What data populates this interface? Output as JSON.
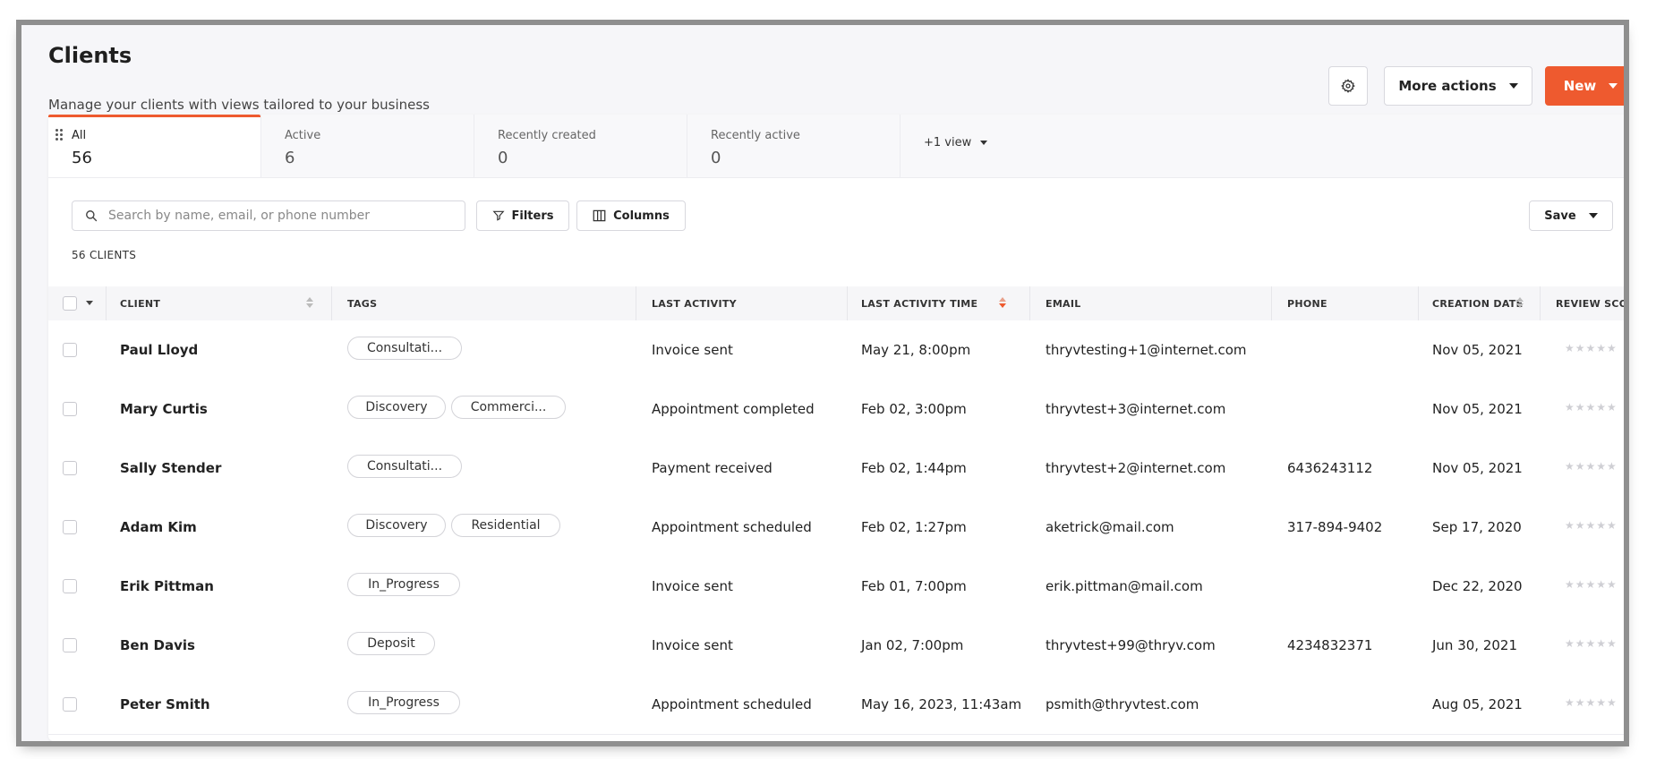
{
  "page": {
    "title": "Clients",
    "subtitle": "Manage your clients with views tailored to your business"
  },
  "actions": {
    "settings_icon": "gear-icon",
    "more_actions_label": "More actions",
    "new_label": "New"
  },
  "colors": {
    "accent": "#ee5a2f"
  },
  "tabs": [
    {
      "label": "All",
      "count": "56"
    },
    {
      "label": "Active",
      "count": "6"
    },
    {
      "label": "Recently created",
      "count": "0"
    },
    {
      "label": "Recently active",
      "count": "0"
    }
  ],
  "tabs_more_label": "+1 view",
  "toolbar": {
    "search_placeholder": "Search by name, email, or phone number",
    "filters_label": "Filters",
    "columns_label": "Columns",
    "save_label": "Save"
  },
  "clients_count_label": "56 CLIENTS",
  "columns": {
    "client": "CLIENT",
    "tags": "TAGS",
    "last_activity": "LAST ACTIVITY",
    "last_activity_time": "LAST ACTIVITY TIME",
    "email": "EMAIL",
    "phone": "PHONE",
    "creation_date": "CREATION DATE",
    "review_score": "REVIEW SCOR"
  },
  "rows": [
    {
      "client": "Paul Lloyd",
      "tags": [
        "Consultati..."
      ],
      "last_activity": "Invoice sent",
      "last_activity_time": "May 21, 8:00pm",
      "email": "thryvtesting+1@internet.com",
      "phone": "",
      "creation_date": "Nov 05, 2021",
      "stars": "★★★★★"
    },
    {
      "client": "Mary Curtis",
      "tags": [
        "Discovery",
        "Commerci..."
      ],
      "last_activity": "Appointment completed",
      "last_activity_time": "Feb 02, 3:00pm",
      "email": "thryvtest+3@internet.com",
      "phone": "",
      "creation_date": "Nov 05, 2021",
      "stars": "★★★★★"
    },
    {
      "client": "Sally Stender",
      "tags": [
        "Consultati..."
      ],
      "last_activity": "Payment received",
      "last_activity_time": "Feb 02, 1:44pm",
      "email": "thryvtest+2@internet.com",
      "phone": "6436243112",
      "creation_date": "Nov 05, 2021",
      "stars": "★★★★★"
    },
    {
      "client": "Adam Kim",
      "tags": [
        "Discovery",
        "Residential"
      ],
      "last_activity": "Appointment scheduled",
      "last_activity_time": "Feb 02, 1:27pm",
      "email": "aketrick@mail.com",
      "phone": "317-894-9402",
      "creation_date": "Sep 17, 2020",
      "stars": "★★★★★"
    },
    {
      "client": "Erik Pittman",
      "tags": [
        "In_Progress"
      ],
      "last_activity": "Invoice sent",
      "last_activity_time": "Feb 01, 7:00pm",
      "email": "erik.pittman@mail.com",
      "phone": "",
      "creation_date": "Dec 22, 2020",
      "stars": "★★★★★"
    },
    {
      "client": "Ben Davis",
      "tags": [
        "Deposit"
      ],
      "last_activity": "Invoice sent",
      "last_activity_time": "Jan 02, 7:00pm",
      "email": "thryvtest+99@thryv.com",
      "phone": "4234832371",
      "creation_date": "Jun 30, 2021",
      "stars": "★★★★★"
    },
    {
      "client": "Peter Smith",
      "tags": [
        "In_Progress"
      ],
      "last_activity": "Appointment scheduled",
      "last_activity_time": "May 16, 2023, 11:43am",
      "email": "psmith@thryvtest.com",
      "phone": "",
      "creation_date": "Aug 05, 2021",
      "stars": "★★★★★"
    }
  ]
}
